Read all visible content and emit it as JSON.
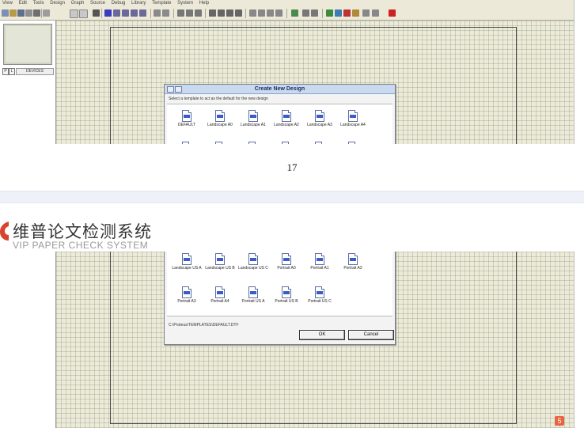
{
  "top_screenshot": {
    "menu": [
      "View",
      "Edit",
      "Tools",
      "Design",
      "Graph",
      "Source",
      "Debug",
      "Library",
      "Template",
      "System",
      "Help"
    ],
    "panel": {
      "tab_p": "P",
      "tab_l": "L",
      "devices_label": "DEVICES"
    },
    "dialog": {
      "title": "Create New Design",
      "hint": "Select a template to act as the default for the new design",
      "templates_row1": [
        "DEFAULT",
        "Landscape A0",
        "Landscape A1",
        "Landscape A2",
        "Landscape A3",
        "Landscape A4"
      ]
    }
  },
  "page_number": "17",
  "watermark": {
    "chinese_name": "维普论文检测系统",
    "english_name": "VIP PAPER CHECK SYSTEM"
  },
  "bottom_screenshot": {
    "dialog": {
      "templates_row2": [
        "Landscape US A",
        "Landscape US B",
        "Landscape US C",
        "Portrait A0",
        "Portrait A1",
        "Portrait A2"
      ],
      "templates_row3": [
        "Portrait A3",
        "Portrait A4",
        "Portrait US A",
        "Portrait US B",
        "Portrait US C"
      ],
      "path": "C:\\Proteus\\TEMPLATES\\DEFAULT.DTF",
      "ok_label": "OK",
      "cancel_label": "Cancel"
    }
  },
  "colors": {
    "logo_red": "#d8432b",
    "grid_bg": "#ecebd9",
    "dialog_title_bg": "#c9d9f0"
  }
}
